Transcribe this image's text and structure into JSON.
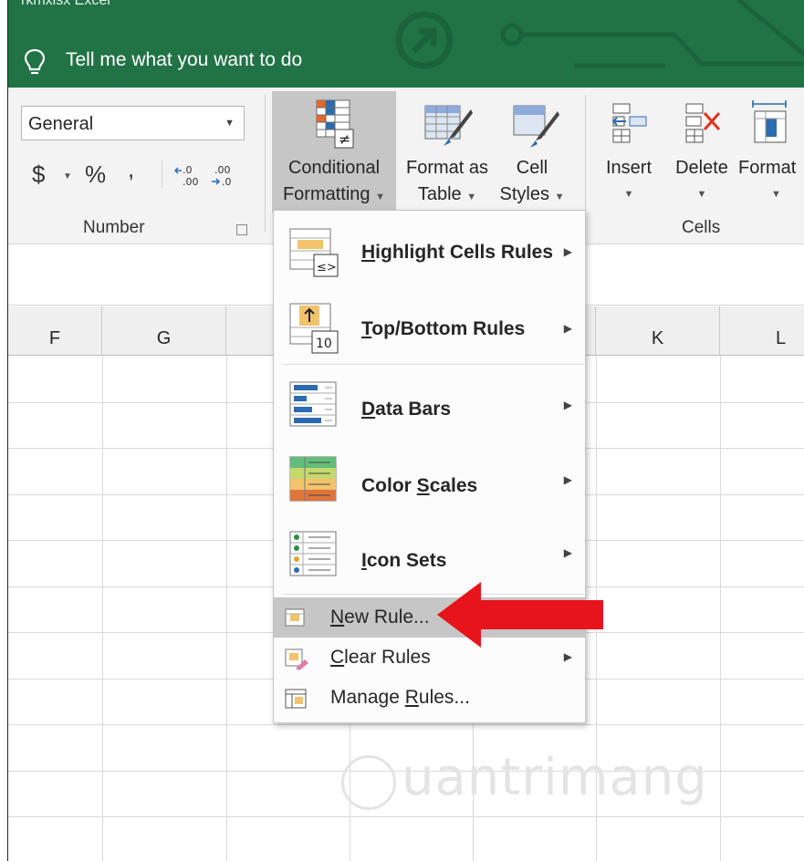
{
  "window": {
    "title_partial": "rkmxisx   Excel"
  },
  "tell_me": {
    "text": "Tell me what you want to do"
  },
  "ribbon": {
    "number_group": {
      "format_value": "General",
      "currency": "$",
      "percent": "%",
      "comma": ",",
      "label": "Number"
    },
    "conditional_formatting": {
      "line1": "Conditional",
      "line2": "Formatting"
    },
    "format_as_table": {
      "line1": "Format as",
      "line2": "Table"
    },
    "cell_styles": {
      "line1": "Cell",
      "line2": "Styles"
    },
    "insert": {
      "label": "Insert"
    },
    "delete": {
      "label": "Delete"
    },
    "format": {
      "label": "Format"
    },
    "cells_group": {
      "label": "Cells"
    }
  },
  "columns": [
    "F",
    "G",
    "K",
    "L"
  ],
  "menu": {
    "items": [
      {
        "id": "highlight",
        "label_pre": "",
        "label_u": "H",
        "label_post": "ighlight Cells Rules",
        "submenu": true
      },
      {
        "id": "topbottom",
        "label_pre": "",
        "label_u": "T",
        "label_post": "op/Bottom Rules",
        "submenu": true
      },
      {
        "id": "databars",
        "label_pre": "",
        "label_u": "D",
        "label_post": "ata Bars",
        "submenu": true
      },
      {
        "id": "colorscales",
        "label_pre": "Color ",
        "label_u": "S",
        "label_post": "cales",
        "submenu": true
      },
      {
        "id": "iconsets",
        "label_pre": "",
        "label_u": "I",
        "label_post": "con Sets",
        "submenu": true
      },
      {
        "id": "newrule",
        "label_pre": "",
        "label_u": "N",
        "label_post": "ew Rule...",
        "submenu": false
      },
      {
        "id": "clearrules",
        "label_pre": "",
        "label_u": "C",
        "label_post": "lear Rules",
        "submenu": true
      },
      {
        "id": "managerules",
        "label_pre": "Manage ",
        "label_u": "R",
        "label_post": "ules...",
        "submenu": false
      }
    ]
  },
  "watermark": {
    "text": "uantrimang"
  },
  "colors": {
    "excel_green": "#217346",
    "ribbon_bg": "#f3f3f3",
    "hover_gray": "#c6c6c6",
    "arrow_red": "#e8141b"
  }
}
